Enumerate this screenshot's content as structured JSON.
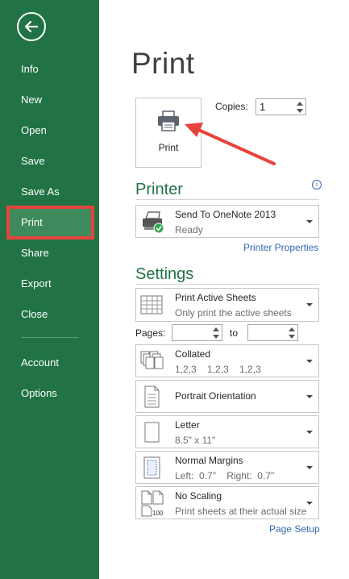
{
  "sidebar": {
    "items": [
      {
        "label": "Info"
      },
      {
        "label": "New"
      },
      {
        "label": "Open"
      },
      {
        "label": "Save"
      },
      {
        "label": "Save As"
      },
      {
        "label": "Print"
      },
      {
        "label": "Share"
      },
      {
        "label": "Export"
      },
      {
        "label": "Close"
      },
      {
        "label": "Account"
      },
      {
        "label": "Options"
      }
    ],
    "active": "Print",
    "background": "#217346"
  },
  "main": {
    "title": "Print",
    "print_button": {
      "label": "Print"
    },
    "copies": {
      "label": "Copies:",
      "value": "1"
    },
    "printer": {
      "section_title": "Printer",
      "name": "Send To OneNote 2013",
      "status": "Ready",
      "properties_link": "Printer Properties",
      "info_icon": "i"
    },
    "settings": {
      "section_title": "Settings",
      "sheets": {
        "title": "Print Active Sheets",
        "subtitle": "Only print the active sheets"
      },
      "pages": {
        "label": "Pages:",
        "to_label": "to",
        "from_value": "",
        "to_value": ""
      },
      "collation": {
        "title": "Collated",
        "subtitle": "1,2,3    1,2,3    1,2,3"
      },
      "orientation": {
        "title": "Portrait Orientation"
      },
      "paper": {
        "title": "Letter",
        "subtitle": "8.5\" x 11\""
      },
      "margins": {
        "title": "Normal Margins",
        "subtitle": "Left:  0.7\"    Right:  0.7\""
      },
      "scaling": {
        "title": "No Scaling",
        "subtitle": "Print sheets at their actual size",
        "icon_text": "100"
      },
      "page_setup_link": "Page Setup"
    }
  },
  "colors": {
    "accent": "#217346",
    "highlight": "#e8433b",
    "link": "#2e6ab1"
  }
}
